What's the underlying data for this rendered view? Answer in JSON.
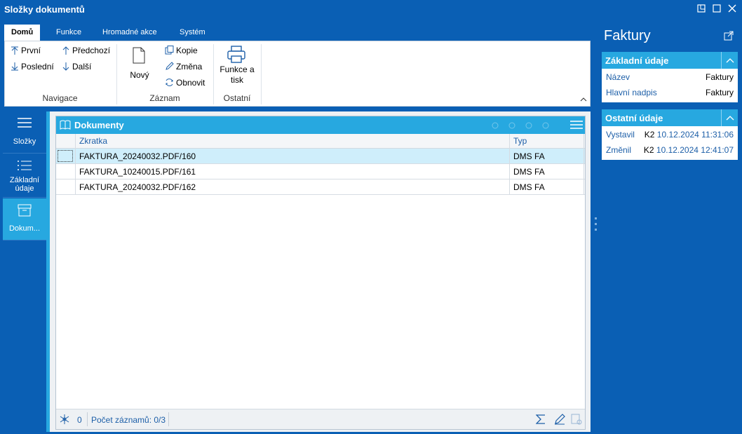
{
  "window": {
    "title": "Složky dokumentů"
  },
  "ribbon": {
    "tabs": [
      "Domů",
      "Funkce",
      "Hromadné akce",
      "Systém"
    ],
    "navigace": {
      "prvni": "První",
      "predchozi": "Předchozí",
      "posledni": "Poslední",
      "dalsi": "Další",
      "label": "Navigace"
    },
    "zaznam": {
      "novy": "Nový",
      "kopie": "Kopie",
      "zmena": "Změna",
      "obnovit": "Obnovit",
      "label": "Záznam"
    },
    "ostatni": {
      "funkce_line1": "Funkce a",
      "funkce_line2": "tisk",
      "label": "Ostatní"
    }
  },
  "sidenav": {
    "items": [
      "Složky",
      "Základní údaje",
      "Dokum..."
    ]
  },
  "panel": {
    "title": "Dokumenty",
    "columns": [
      "Zkratka",
      "Typ"
    ],
    "rows": [
      {
        "zkratka": "FAKTURA_20240032.PDF/160",
        "typ": "DMS FA"
      },
      {
        "zkratka": "FAKTURA_10240015.PDF/161",
        "typ": "DMS FA"
      },
      {
        "zkratka": "FAKTURA_20240032.PDF/162",
        "typ": "DMS FA"
      }
    ],
    "status": {
      "filter_count": "0",
      "records": "Počet záznamů: 0/3"
    }
  },
  "right": {
    "title": "Faktury",
    "zakladni": {
      "header": "Základní údaje",
      "nazev_label": "Název",
      "nazev_value": "Faktury",
      "nadpis_label": "Hlavní nadpis",
      "nadpis_value": "Faktury"
    },
    "ostatni": {
      "header": "Ostatní údaje",
      "vystavil_label": "Vystavil",
      "vystavil_user": "K2",
      "vystavil_date": "10.12.2024 11:31:06",
      "zmenil_label": "Změnil",
      "zmenil_user": "K2",
      "zmenil_date": "10.12.2024 12:41:07"
    }
  },
  "colors": {
    "brand": "#0a5fb4",
    "accent": "#27a8e0",
    "selection": "#cfeefb"
  }
}
